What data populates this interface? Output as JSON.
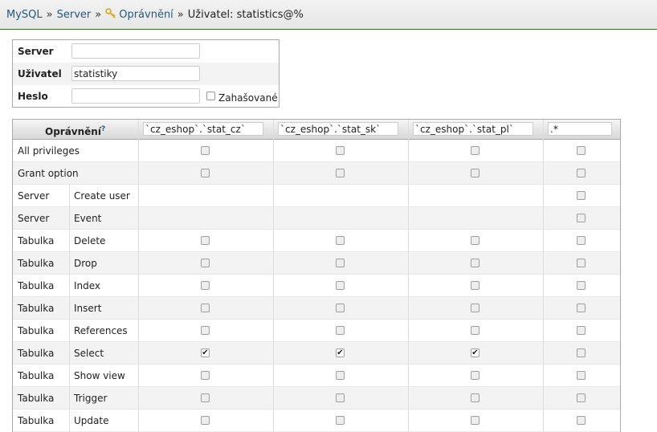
{
  "breadcrumb": {
    "mysql": "MySQL",
    "server": "Server",
    "privileges": "Oprávnění",
    "current": "Uživatel: statistics@%",
    "separator": "»"
  },
  "login": {
    "server_label": "Server",
    "server_value": "",
    "user_label": "Uživatel",
    "user_value": "statistiky",
    "password_label": "Heslo",
    "password_value": "",
    "hashed_label": "Zahašované"
  },
  "table": {
    "header_title": "Oprávnění",
    "header_help": "?",
    "databases": [
      "`cz_eshop`.`stat_cz`",
      "`cz_eshop`.`stat_sk`",
      "`cz_eshop`.`stat_pl`",
      ".*"
    ],
    "rows": [
      {
        "scope": "All privileges",
        "name": "",
        "checks": [
          false,
          false,
          false,
          false
        ]
      },
      {
        "scope": "Grant option",
        "name": "",
        "checks": [
          false,
          false,
          false,
          false
        ]
      },
      {
        "scope": "Server",
        "name": "Create user",
        "checks": [
          null,
          null,
          null,
          false
        ]
      },
      {
        "scope": "Server",
        "name": "Event",
        "checks": [
          null,
          null,
          null,
          false
        ]
      },
      {
        "scope": "Tabulka",
        "name": "Delete",
        "checks": [
          false,
          false,
          false,
          false
        ]
      },
      {
        "scope": "Tabulka",
        "name": "Drop",
        "checks": [
          false,
          false,
          false,
          false
        ]
      },
      {
        "scope": "Tabulka",
        "name": "Index",
        "checks": [
          false,
          false,
          false,
          false
        ]
      },
      {
        "scope": "Tabulka",
        "name": "Insert",
        "checks": [
          false,
          false,
          false,
          false
        ]
      },
      {
        "scope": "Tabulka",
        "name": "References",
        "checks": [
          false,
          false,
          false,
          false
        ]
      },
      {
        "scope": "Tabulka",
        "name": "Select",
        "checks": [
          true,
          true,
          true,
          false
        ]
      },
      {
        "scope": "Tabulka",
        "name": "Show view",
        "checks": [
          false,
          false,
          false,
          false
        ]
      },
      {
        "scope": "Tabulka",
        "name": "Trigger",
        "checks": [
          false,
          false,
          false,
          false
        ]
      },
      {
        "scope": "Tabulka",
        "name": "Update",
        "checks": [
          false,
          false,
          false,
          false
        ]
      }
    ]
  },
  "colors": {
    "link": "#235a81",
    "topbar_border": "#3a6e2c"
  },
  "icons": {
    "privileges": "key-icon"
  }
}
